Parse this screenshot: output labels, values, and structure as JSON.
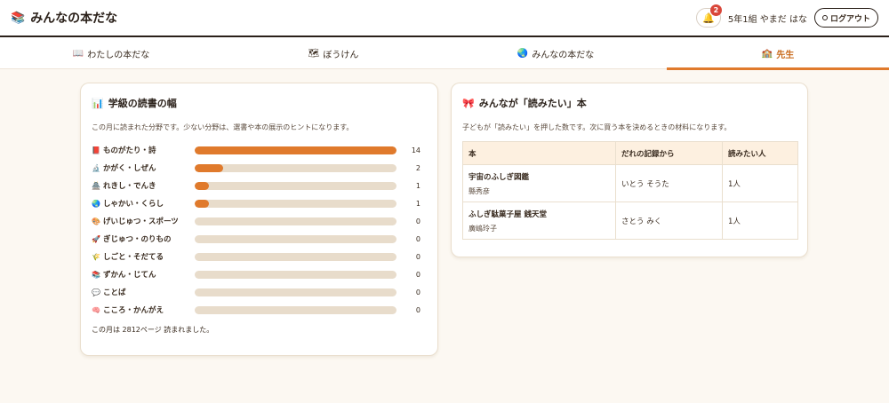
{
  "header": {
    "icon": "books-icon",
    "title": "みんなの本だな",
    "notification_count": "2",
    "user": "5年1組 やまだ はな",
    "logout_label": "ログアウト"
  },
  "tabs": [
    {
      "icon": "📖",
      "label": "わたしの本だな"
    },
    {
      "icon": "🗺",
      "label": "ぼうけん"
    },
    {
      "icon": "🌏",
      "label": "みんなの本だな"
    },
    {
      "icon": "🏫",
      "label": "先生"
    }
  ],
  "active_tab": 3,
  "breadth": {
    "icon": "📊",
    "title": "学級の読書の幅",
    "description": "この月に読まれた分野です。少ない分野は、選書や本の展示のヒントになります。",
    "max": 14,
    "rows": [
      {
        "icon": "📕",
        "label": "ものがたり・詩",
        "count": 14
      },
      {
        "icon": "🔬",
        "label": "かがく・しぜん",
        "count": 2
      },
      {
        "icon": "🏯",
        "label": "れきし・でんき",
        "count": 1
      },
      {
        "icon": "🌏",
        "label": "しゃかい・くらし",
        "count": 1
      },
      {
        "icon": "🎨",
        "label": "げいじゅつ・スポーツ",
        "count": 0
      },
      {
        "icon": "🚀",
        "label": "ぎじゅつ・のりもの",
        "count": 0
      },
      {
        "icon": "🌾",
        "label": "しごと・そだてる",
        "count": 0
      },
      {
        "icon": "📚",
        "label": "ずかん・じてん",
        "count": 0
      },
      {
        "icon": "💬",
        "label": "ことば",
        "count": 0
      },
      {
        "icon": "🧠",
        "label": "こころ・かんがえ",
        "count": 0
      }
    ],
    "footnote": "この月は 2812ページ 読まれました。"
  },
  "wants": {
    "icon": "🎀",
    "title": "みんなが「読みたい」本",
    "description": "子どもが「読みたい」を押した数です。次に買う本を決めるときの材料になります。",
    "headers": [
      "本",
      "だれの記録から",
      "読みたい人"
    ],
    "rows": [
      {
        "title": "宇宙のふしぎ図鑑",
        "author": "縣秀彦",
        "from": "いとう そうた",
        "count": "1人"
      },
      {
        "title": "ふしぎ駄菓子屋 銭天堂",
        "author": "廣嶋玲子",
        "from": "さとう みく",
        "count": "1人"
      }
    ]
  }
}
